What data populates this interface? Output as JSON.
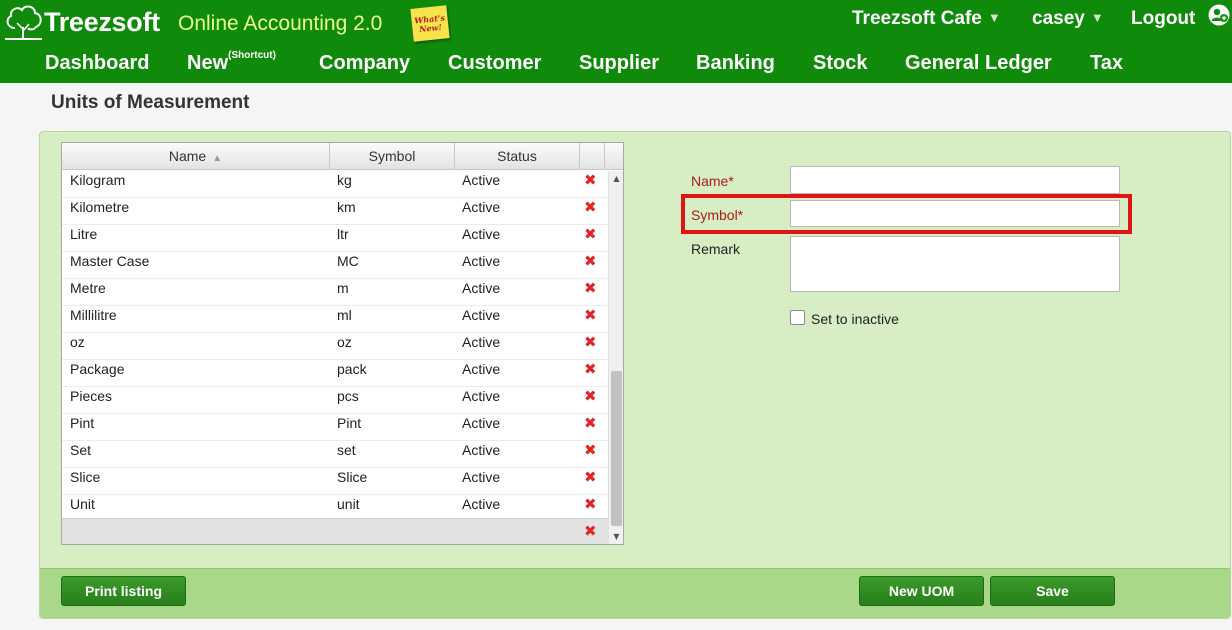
{
  "header": {
    "brand": "Treezsoft",
    "product": "Online Accounting 2.0",
    "whats_new": "What's New!",
    "company": "Treezsoft Cafe",
    "user": "casey",
    "logout": "Logout",
    "caret": "▼",
    "brand_color": "#108a0a",
    "product_color": "#e8ff8e"
  },
  "nav": {
    "dashboard": "Dashboard",
    "new": "New",
    "new_sup": "(Shortcut)",
    "company": "Company",
    "customer": "Customer",
    "supplier": "Supplier",
    "banking": "Banking",
    "stock": "Stock",
    "general_ledger": "General Ledger",
    "tax": "Tax"
  },
  "page": {
    "title": "Units of Measurement"
  },
  "grid": {
    "columns": {
      "name": "Name",
      "sort_indicator": "▲",
      "symbol": "Symbol",
      "status": "Status"
    },
    "delete_glyph": "✖",
    "rows": [
      {
        "name": "Kilogram",
        "symbol": "kg",
        "status": "Active"
      },
      {
        "name": "Kilometre",
        "symbol": "km",
        "status": "Active"
      },
      {
        "name": "Litre",
        "symbol": "ltr",
        "status": "Active"
      },
      {
        "name": "Master Case",
        "symbol": "MC",
        "status": "Active"
      },
      {
        "name": "Metre",
        "symbol": "m",
        "status": "Active"
      },
      {
        "name": "Millilitre",
        "symbol": "ml",
        "status": "Active"
      },
      {
        "name": "oz",
        "symbol": "oz",
        "status": "Active"
      },
      {
        "name": "Package",
        "symbol": "pack",
        "status": "Active"
      },
      {
        "name": "Pieces",
        "symbol": "pcs",
        "status": "Active"
      },
      {
        "name": "Pint",
        "symbol": "Pint",
        "status": "Active"
      },
      {
        "name": "Set",
        "symbol": "set",
        "status": "Active"
      },
      {
        "name": "Slice",
        "symbol": "Slice",
        "status": "Active"
      },
      {
        "name": "Unit",
        "symbol": "unit",
        "status": "Active"
      }
    ]
  },
  "form": {
    "name_label": "Name*",
    "name_value": "",
    "symbol_label": "Symbol*",
    "symbol_value": "",
    "remark_label": "Remark",
    "remark_value": "",
    "inactive_label": "Set to inactive",
    "inactive_checked": false,
    "required_color": "#a6201a",
    "highlight_color": "#e01414"
  },
  "buttons": {
    "print": "Print listing",
    "new_uom": "New UOM",
    "save": "Save"
  }
}
